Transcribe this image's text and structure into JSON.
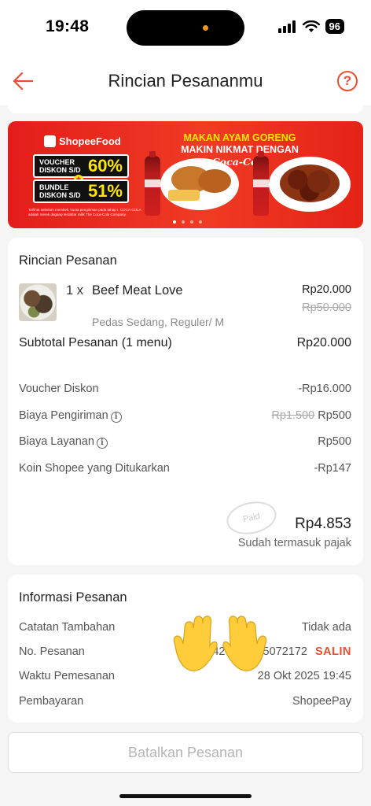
{
  "status_bar": {
    "time": "19:48",
    "battery": "96"
  },
  "header": {
    "title": "Rincian Pesananmu",
    "help_icon": "?"
  },
  "banner": {
    "brand": "ShopeeFood",
    "voucher_label": "VOUCHER DISKON S/D",
    "voucher_pct": "60%",
    "bundle_label": "BUNDLE DISKON S/D",
    "bundle_pct": "51%",
    "headline_line1": "MAKAN AYAM GORENG",
    "headline_line2": "MAKIN NIKMAT DENGAN",
    "brand2": "Coca-Cola",
    "fine_print": "Terlihat sebelum membeli, kuota pengiriman pada tahap I. COCA-COLA adalah merek dagang terdaftar milik The Coca-Cola Company.",
    "slides": 4,
    "active_slide": 1
  },
  "order_details": {
    "title": "Rincian Pesanan",
    "item": {
      "qty": "1 x",
      "name": "Beef Meat Love",
      "price": "Rp20.000",
      "original_price": "Rp50.000",
      "variant": "Pedas Sedang, Reguler/ M"
    },
    "subtotal_label": "Subtotal Pesanan (1 menu)",
    "subtotal_value": "Rp20.000",
    "rows": [
      {
        "label": "Voucher Diskon",
        "value": "-Rp16.000"
      },
      {
        "label": "Biaya Pengiriman",
        "original": "Rp1.500",
        "value": "Rp500"
      },
      {
        "label": "Biaya Layanan",
        "value": "Rp500"
      },
      {
        "label": "Koin Shopee yang Ditukarkan",
        "value": "-Rp147"
      }
    ],
    "total": "Rp4.853",
    "total_note": "Sudah termasuk pajak",
    "stamp": "Paid"
  },
  "order_info": {
    "title": "Informasi Pesanan",
    "notes_label": "Catatan Tambahan",
    "notes_value": "Tidak ada",
    "order_no_label": "No. Pesanan",
    "order_no_value": "42",
    "order_no_value_end": "35072172",
    "copy_label": "SALIN",
    "time_label": "Waktu Pemesanan",
    "time_value": "28 Okt 2025 19:45",
    "payment_label": "Pembayaran",
    "payment_value": "ShopeePay"
  },
  "cancel_button": "Batalkan Pesanan",
  "colors": {
    "accent": "#ee4d2d",
    "banner_red": "#e31d1a",
    "highlight_yellow": "#ffe600"
  }
}
